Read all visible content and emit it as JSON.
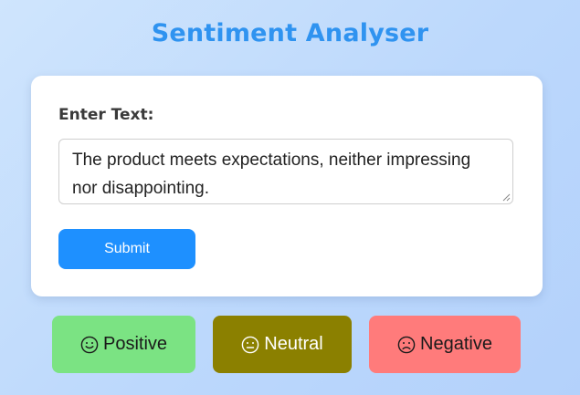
{
  "app": {
    "title": "Sentiment Analyser"
  },
  "form": {
    "label": "Enter Text:",
    "text_value": "The product meets expectations, neither impressing nor disappointing.",
    "submit_label": "Submit"
  },
  "sentiments": [
    {
      "label": "Positive",
      "icon": "smile-icon",
      "color": "#7be383"
    },
    {
      "label": "Neutral",
      "icon": "neutral-face-icon",
      "color": "#8b8000"
    },
    {
      "label": "Negative",
      "icon": "frown-icon",
      "color": "#ff7b7b"
    }
  ],
  "colors": {
    "accent": "#1e90ff",
    "title": "#2f93f0"
  }
}
